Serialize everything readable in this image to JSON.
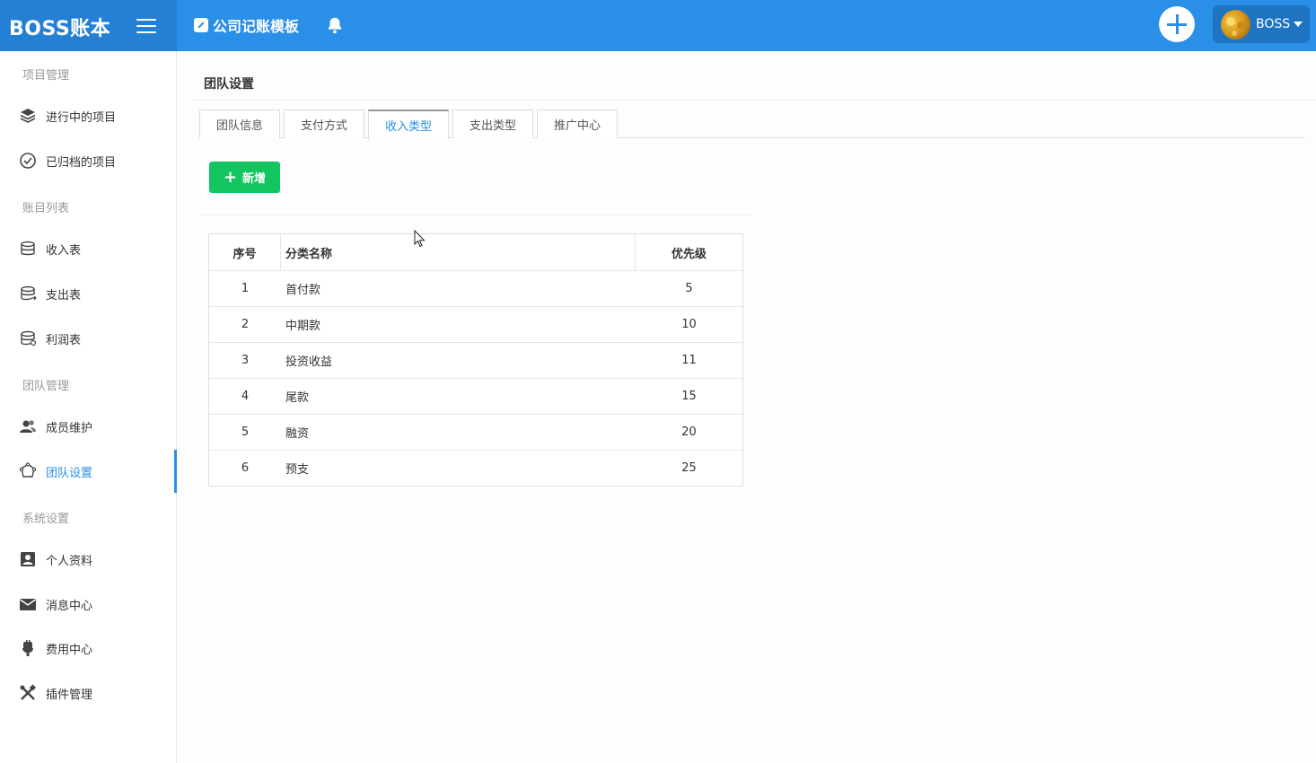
{
  "app": {
    "brand": "BOSS账本"
  },
  "header": {
    "template_link": "公司记账模板",
    "user_name": "BOSS"
  },
  "sidebar": {
    "sections": [
      {
        "title": "项目管理",
        "items": [
          {
            "label": "进行中的项目",
            "icon": "layers-icon"
          },
          {
            "label": "已归档的项目",
            "icon": "check-circle-icon"
          }
        ]
      },
      {
        "title": "账目列表",
        "items": [
          {
            "label": "收入表",
            "icon": "database-icon"
          },
          {
            "label": "支出表",
            "icon": "database-out-icon"
          },
          {
            "label": "利润表",
            "icon": "database-profit-icon"
          }
        ]
      },
      {
        "title": "团队管理",
        "items": [
          {
            "label": "成员维护",
            "icon": "users-icon"
          },
          {
            "label": "团队设置",
            "icon": "team-settings-icon",
            "active": true
          }
        ]
      },
      {
        "title": "系统设置",
        "items": [
          {
            "label": "个人资料",
            "icon": "profile-icon"
          },
          {
            "label": "消息中心",
            "icon": "envelope-icon"
          },
          {
            "label": "费用中心",
            "icon": "coin-hand-icon"
          },
          {
            "label": "插件管理",
            "icon": "tools-icon"
          }
        ]
      }
    ]
  },
  "main": {
    "title": "团队设置",
    "tabs": [
      {
        "label": "团队信息"
      },
      {
        "label": "支付方式"
      },
      {
        "label": "收入类型",
        "active": true
      },
      {
        "label": "支出类型"
      },
      {
        "label": "推广中心"
      }
    ],
    "add_button": "新增",
    "table": {
      "headers": [
        "序号",
        "分类名称",
        "优先级"
      ],
      "rows": [
        [
          "1",
          "首付款",
          "5"
        ],
        [
          "2",
          "中期款",
          "10"
        ],
        [
          "3",
          "投资收益",
          "11"
        ],
        [
          "4",
          "尾款",
          "15"
        ],
        [
          "5",
          "融资",
          "20"
        ],
        [
          "6",
          "预支",
          "25"
        ]
      ]
    }
  },
  "colors": {
    "primary": "#2a8fe6",
    "brand_bg": "#2380d4",
    "success": "#12c55f"
  }
}
